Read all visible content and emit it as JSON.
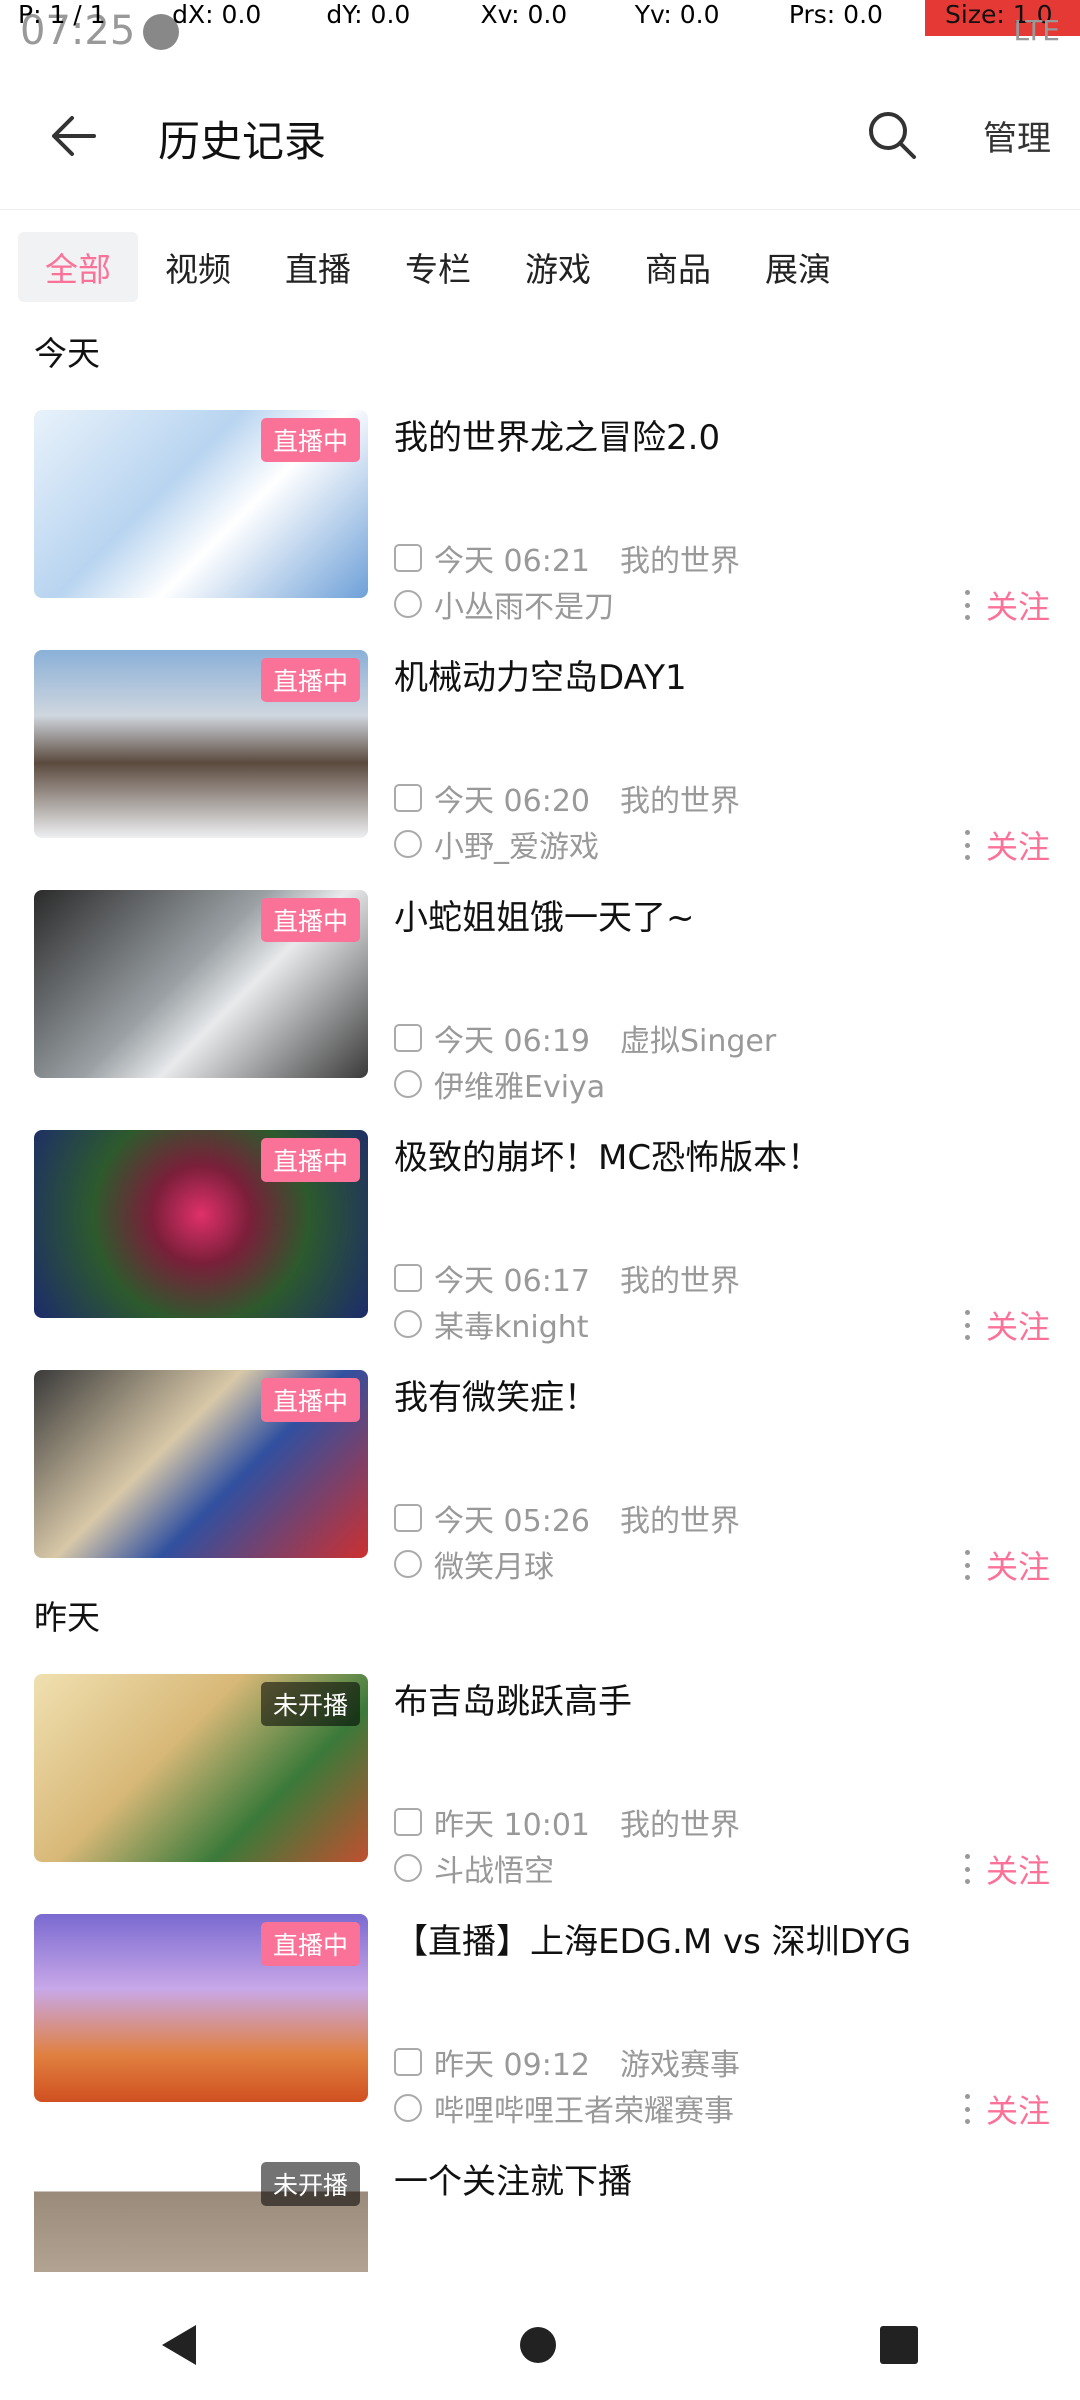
{
  "status": {
    "time": "07:25",
    "network": "LTE",
    "debug": {
      "pointer": "P: 1 / 1",
      "dx": "dX: 0.0",
      "dy": "dY: 0.0",
      "xv": "Xv: 0.0",
      "yv": "Yv: 0.0",
      "prs": "Prs: 0.0",
      "size": "Size: 1.0"
    }
  },
  "header": {
    "title": "历史记录",
    "manage_label": "管理"
  },
  "tabs": [
    "全部",
    "视频",
    "直播",
    "专栏",
    "游戏",
    "商品",
    "展演"
  ],
  "sections": [
    {
      "title": "今天",
      "items": [
        {
          "title": "我的世界龙之冒险2.0",
          "badge": "直播中",
          "time": "今天 06:21",
          "area": "我的世界",
          "uploader": "小丛雨不是刀",
          "follow": "关注"
        },
        {
          "title": "机械动力空岛DAY1",
          "badge": "直播中",
          "time": "今天 06:20",
          "area": "我的世界",
          "uploader": "小野_爱游戏",
          "follow": "关注"
        },
        {
          "title": "小蛇姐姐饿一天了~",
          "badge": "直播中",
          "time": "今天 06:19",
          "area": "虚拟Singer",
          "uploader": "伊维雅Eviya",
          "follow": ""
        },
        {
          "title": "极致的崩坏！MC恐怖版本！",
          "badge": "直播中",
          "time": "今天 06:17",
          "area": "我的世界",
          "uploader": "某毒knight",
          "follow": "关注"
        },
        {
          "title": "我有微笑症！",
          "badge": "直播中",
          "time": "今天 05:26",
          "area": "我的世界",
          "uploader": "微笑月球",
          "follow": "关注"
        }
      ]
    },
    {
      "title": "昨天",
      "items": [
        {
          "title": "布吉岛跳跃高手",
          "badge": "未开播",
          "time": "昨天 10:01",
          "area": "我的世界",
          "uploader": "斗战悟空",
          "follow": "关注"
        },
        {
          "title": "【直播】上海EDG.M vs 深圳DYG",
          "badge": "直播中",
          "time": "昨天 09:12",
          "area": "游戏赛事",
          "uploader": "哔哩哔哩王者荣耀赛事",
          "follow": "关注"
        },
        {
          "title": "一个关注就下播",
          "badge": "未开播",
          "time": "",
          "area": "",
          "uploader": "",
          "follow": ""
        }
      ]
    }
  ],
  "colors": {
    "accent": "#fb7299",
    "muted": "#999999"
  },
  "thumb_styles": [
    "linear-gradient(135deg,#e8f2fb 0%,#b8d4f0 40%,#ffffff 60%,#6ea0d8 100%)",
    "linear-gradient(180deg,#8ab0d8 0%,#cfd6de 35%,#5b4a3e 60%,#eef0f2 100%)",
    "linear-gradient(135deg,#2a2a2a 0%,#9aa0a4 45%,#e8eaec 60%,#3a3a3a 100%)",
    "radial-gradient(circle at 50% 45%,#e0306a 0%,#7a1f3a 25%,#2d5a2d 55%,#1c2b6b 100%)",
    "linear-gradient(135deg,#3a3a3a 0%,#d8c8a8 40%,#3050a0 60%,#cc3030 100%)",
    "linear-gradient(135deg,#f0e0b0 0%,#d8b878 40%,#3a7a3a 70%,#c05030 100%)",
    "linear-gradient(180deg,#7a6ad0 0%,#c8a8e8 40%,#e08040 75%,#d05020 100%)",
    "linear-gradient(180deg,#ffffff 0%,#ffffff 20%,#9a8a7a 20%,#c8b8a8 100%)"
  ]
}
